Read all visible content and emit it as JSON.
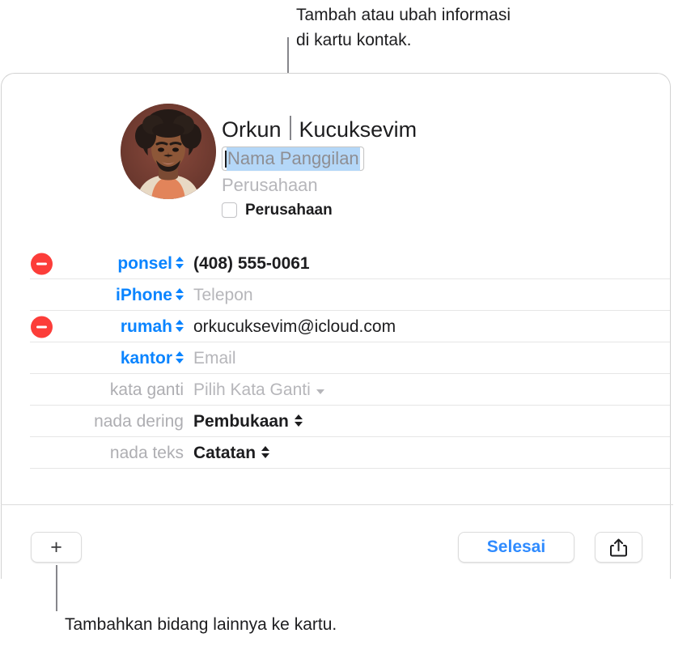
{
  "callouts": {
    "top": "Tambah atau ubah informasi\ndi kartu kontak.",
    "bottom": "Tambahkan bidang lainnya ke kartu."
  },
  "contact_card": {
    "avatar_alt": "contact-photo",
    "first_name": "Orkun",
    "last_name": "Kucuksevim",
    "nickname_placeholder": "Nama Panggilan",
    "company_placeholder": "Perusahaan",
    "company_checkbox_label": "Perusahaan",
    "company_checkbox_checked": false,
    "fields": [
      {
        "id": "phone-mobile",
        "has_remove": true,
        "label": "ponsel",
        "label_style": "blue",
        "has_stepper": true,
        "value": "(408) 555-0061",
        "value_style": "bold",
        "is_placeholder": false
      },
      {
        "id": "phone-iphone",
        "has_remove": false,
        "label": "iPhone",
        "label_style": "blue",
        "has_stepper": true,
        "value": "Telepon",
        "value_style": "normal",
        "is_placeholder": true
      },
      {
        "id": "email-home",
        "has_remove": true,
        "label": "rumah",
        "label_style": "blue",
        "has_stepper": true,
        "value": "orkucuksevim@icloud.com",
        "value_style": "normal",
        "is_placeholder": false
      },
      {
        "id": "email-work",
        "has_remove": false,
        "label": "kantor",
        "label_style": "blue",
        "has_stepper": true,
        "value": "Email",
        "value_style": "normal",
        "is_placeholder": true
      },
      {
        "id": "pronouns",
        "has_remove": false,
        "label": "kata ganti",
        "label_style": "grey",
        "has_stepper": false,
        "value": "Pilih Kata Ganti",
        "value_style": "normal",
        "is_placeholder": true,
        "has_chevron": true
      },
      {
        "id": "ringtone",
        "has_remove": false,
        "label": "nada dering",
        "label_style": "grey",
        "has_stepper": false,
        "value": "Pembukaan",
        "value_style": "semibold",
        "is_placeholder": false,
        "value_stepper": true
      },
      {
        "id": "text-tone",
        "has_remove": false,
        "label": "nada teks",
        "label_style": "grey",
        "has_stepper": false,
        "value": "Catatan",
        "value_style": "semibold",
        "is_placeholder": false,
        "value_stepper": true
      }
    ]
  },
  "toolbar": {
    "add_label": "+",
    "done_label": "Selesai",
    "share_icon": "share-icon"
  },
  "colors": {
    "accent_blue": "#0a84ff",
    "done_blue": "#2f8bff",
    "remove_red": "#fc3d39",
    "selection_blue": "#b4d7f8",
    "placeholder_grey": "#b6b6ba",
    "label_grey": "#aeaeb2",
    "divider": "#e6e6e6",
    "card_border": "#d2d2d2"
  }
}
